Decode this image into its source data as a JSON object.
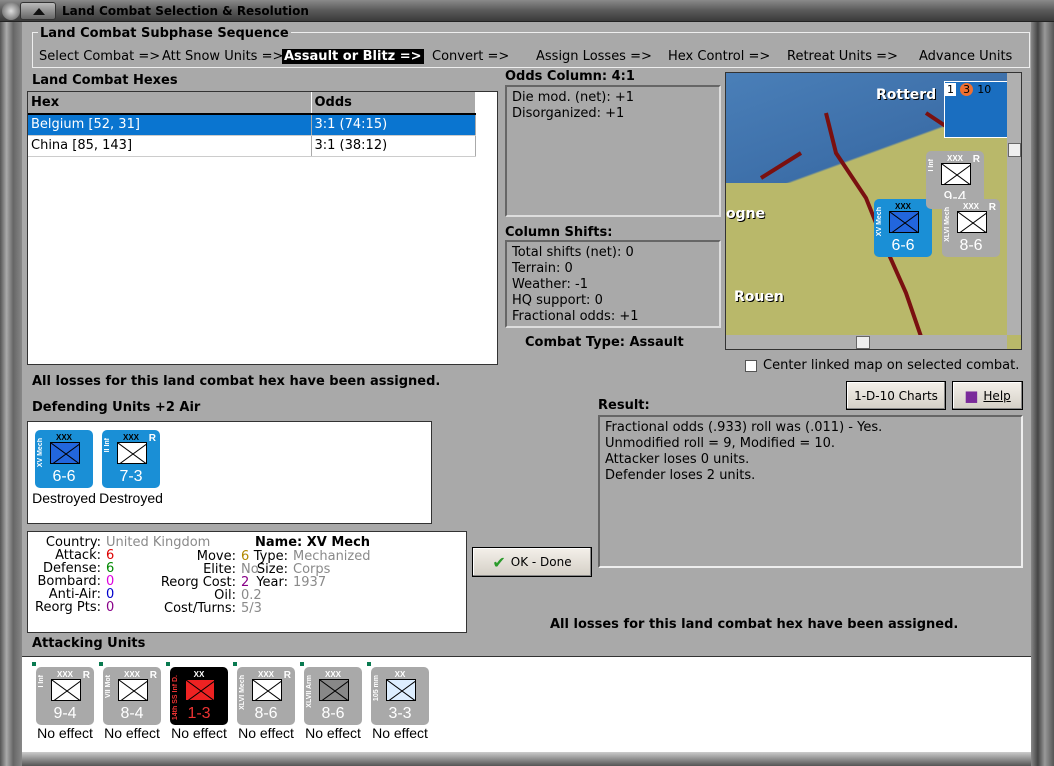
{
  "window": {
    "title": "Land Combat Selection & Resolution"
  },
  "subphase": {
    "title": "Land Combat Subphase Sequence",
    "steps": [
      "Select Combat =>",
      "Att Snow Units =>",
      "Assault or Blitz =>",
      "Convert =>",
      "Assign Losses =>",
      "Hex Control =>",
      "Retreat Units =>",
      "Advance Units"
    ],
    "active_index": 2
  },
  "hexes": {
    "label": "Land Combat Hexes",
    "columns": [
      "Hex",
      "Odds"
    ],
    "rows": [
      {
        "hex": "Belgium [52, 31]",
        "odds": "3:1 (74:15)",
        "selected": true
      },
      {
        "hex": "China [85, 143]",
        "odds": "3:1 (38:12)",
        "selected": false
      }
    ]
  },
  "odds": {
    "label": "Odds Column: 4:1",
    "lines": [
      "Die mod. (net): +1",
      "Disorganized: +1"
    ]
  },
  "shifts": {
    "label": "Column Shifts:",
    "lines": [
      "Total shifts (net): 0",
      "Terrain: 0",
      "Weather: -1",
      "HQ support: 0",
      "Fractional odds: +1"
    ]
  },
  "combat_type": "Combat Type:  Assault",
  "map": {
    "labels": [
      "Rotterd",
      "ogne",
      "Rouen"
    ],
    "stack_numbers": [
      "1",
      "3",
      "10"
    ]
  },
  "center_map": {
    "label": "Center linked map on selected combat.",
    "checked": false
  },
  "losses_msg": "All losses for this land combat hex have been assigned.",
  "buttons": {
    "charts": "1-D-10 Charts",
    "help": "Help",
    "ok": "OK - Done"
  },
  "defending": {
    "label": "Defending Units +2 Air",
    "units": [
      {
        "name": "XV Mech",
        "size": "XXX",
        "value": "6-6",
        "status": "Destroyed",
        "reserve": false,
        "color": "#1a8fd6",
        "sym_color": "#2266dd"
      },
      {
        "name": "II Inf",
        "size": "XXX",
        "value": "7-3",
        "status": "Destroyed",
        "reserve": true,
        "color": "#1a8fd6",
        "sym_color": "#ffffff"
      }
    ]
  },
  "result": {
    "label": "Result:",
    "lines": [
      "Fractional odds (.933) roll was (.011)  - Yes.",
      "Unmodified roll = 9, Modified = 10.",
      "Attacker loses 0 units.",
      "Defender loses 2 units."
    ]
  },
  "unit_info": {
    "col1": [
      {
        "k": "Country:",
        "v": "United Kingdom",
        "c": "#8a8a8a"
      },
      {
        "k": "Attack:",
        "v": "6",
        "c": "#dd0000"
      },
      {
        "k": "Defense:",
        "v": "6",
        "c": "#008800"
      },
      {
        "k": "Bombard:",
        "v": "0",
        "c": "#dd00dd"
      },
      {
        "k": "Anti-Air:",
        "v": "0",
        "c": "#0000cc"
      },
      {
        "k": "Reorg Pts:",
        "v": "0",
        "c": "#880088"
      }
    ],
    "col2": [
      {
        "k": "Move:",
        "v": "6",
        "c": "#b08800"
      },
      {
        "k": "Elite:",
        "v": "No",
        "c": "#8a8a8a"
      },
      {
        "k": "Reorg Cost:",
        "v": "2",
        "c": "#880088"
      },
      {
        "k": "Oil:",
        "v": "0.2",
        "c": "#8a8a8a"
      },
      {
        "k": "Cost/Turns:",
        "v": "5/3",
        "c": "#8a8a8a"
      }
    ],
    "name": "Name: XV Mech",
    "col3": [
      {
        "k": "Type:",
        "v": "Mechanized",
        "c": "#8a8a8a"
      },
      {
        "k": "Size:",
        "v": "Corps",
        "c": "#8a8a8a"
      },
      {
        "k": "Year:",
        "v": "1937",
        "c": "#8a8a8a"
      }
    ]
  },
  "attacking": {
    "label": "Attacking Units",
    "units": [
      {
        "name": "I Inf",
        "size": "XXX",
        "value": "9-4",
        "status": "No effect",
        "reserve": true,
        "color": "#a9a9a9",
        "sym_color": "#ffffff"
      },
      {
        "name": "VII Mot",
        "size": "XXX",
        "value": "8-4",
        "status": "No effect",
        "reserve": true,
        "color": "#a9a9a9",
        "sym_color": "#ffffff"
      },
      {
        "name": "14th SS Inf D.",
        "size": "XX",
        "value": "1-3",
        "status": "No effect",
        "reserve": false,
        "color": "#000000",
        "sym_color": "#ee2222"
      },
      {
        "name": "XLVI Mech",
        "size": "XXX",
        "value": "8-6",
        "status": "No effect",
        "reserve": true,
        "color": "#a9a9a9",
        "sym_color": "#ffffff"
      },
      {
        "name": "XLVII Arm",
        "size": "XXX",
        "value": "8-6",
        "status": "No effect",
        "reserve": false,
        "color": "#a9a9a9",
        "sym_color": "#888888"
      },
      {
        "name": "105 mm",
        "size": "XX",
        "value": "3-3",
        "status": "No effect",
        "reserve": false,
        "color": "#a9a9a9",
        "sym_color": "#ddeeff"
      }
    ]
  },
  "colors": {
    "selection": "#0a75d0",
    "panel": "#a9a9a9"
  }
}
